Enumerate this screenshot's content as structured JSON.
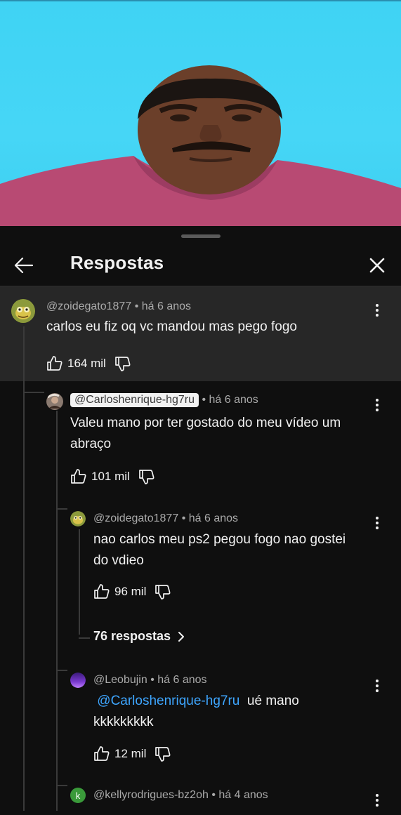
{
  "panel": {
    "title": "Respostas"
  },
  "comments": [
    {
      "author": "@zoidegato1877",
      "time": "há 6 anos",
      "text": "carlos eu fiz oq vc mandou mas pego fogo",
      "likes": "164 mil"
    },
    {
      "author": "@Carloshenrique-hg7ru",
      "time": "há 6 anos",
      "text_line1": "Valeu mano por ter gostado do meu vídeo um",
      "text_line2": "abraço",
      "likes": "101 mil"
    },
    {
      "author": "@zoidegato1877",
      "time": "há 6 anos",
      "text_line1": "nao carlos meu ps2 pegou fogo nao gostei",
      "text_line2": "do vdieo",
      "likes": "96 mil",
      "replies_label": "76 respostas"
    },
    {
      "author": "@Leobujin",
      "time": "há 6 anos",
      "mention": "@Carloshenrique-hg7ru",
      "text_line1_rest": "ué mano",
      "text_line2": "kkkkkkkkk",
      "likes": "12 mil"
    },
    {
      "author": "@kellyrodrigues-bz2oh",
      "time": "há 4 anos",
      "avatar_letter": "k"
    }
  ],
  "separator": "•",
  "colors": {
    "background": "#0f0f0f",
    "highlight": "#272727",
    "mention": "#3ea6ff",
    "video_bg": "#46d6f6"
  }
}
